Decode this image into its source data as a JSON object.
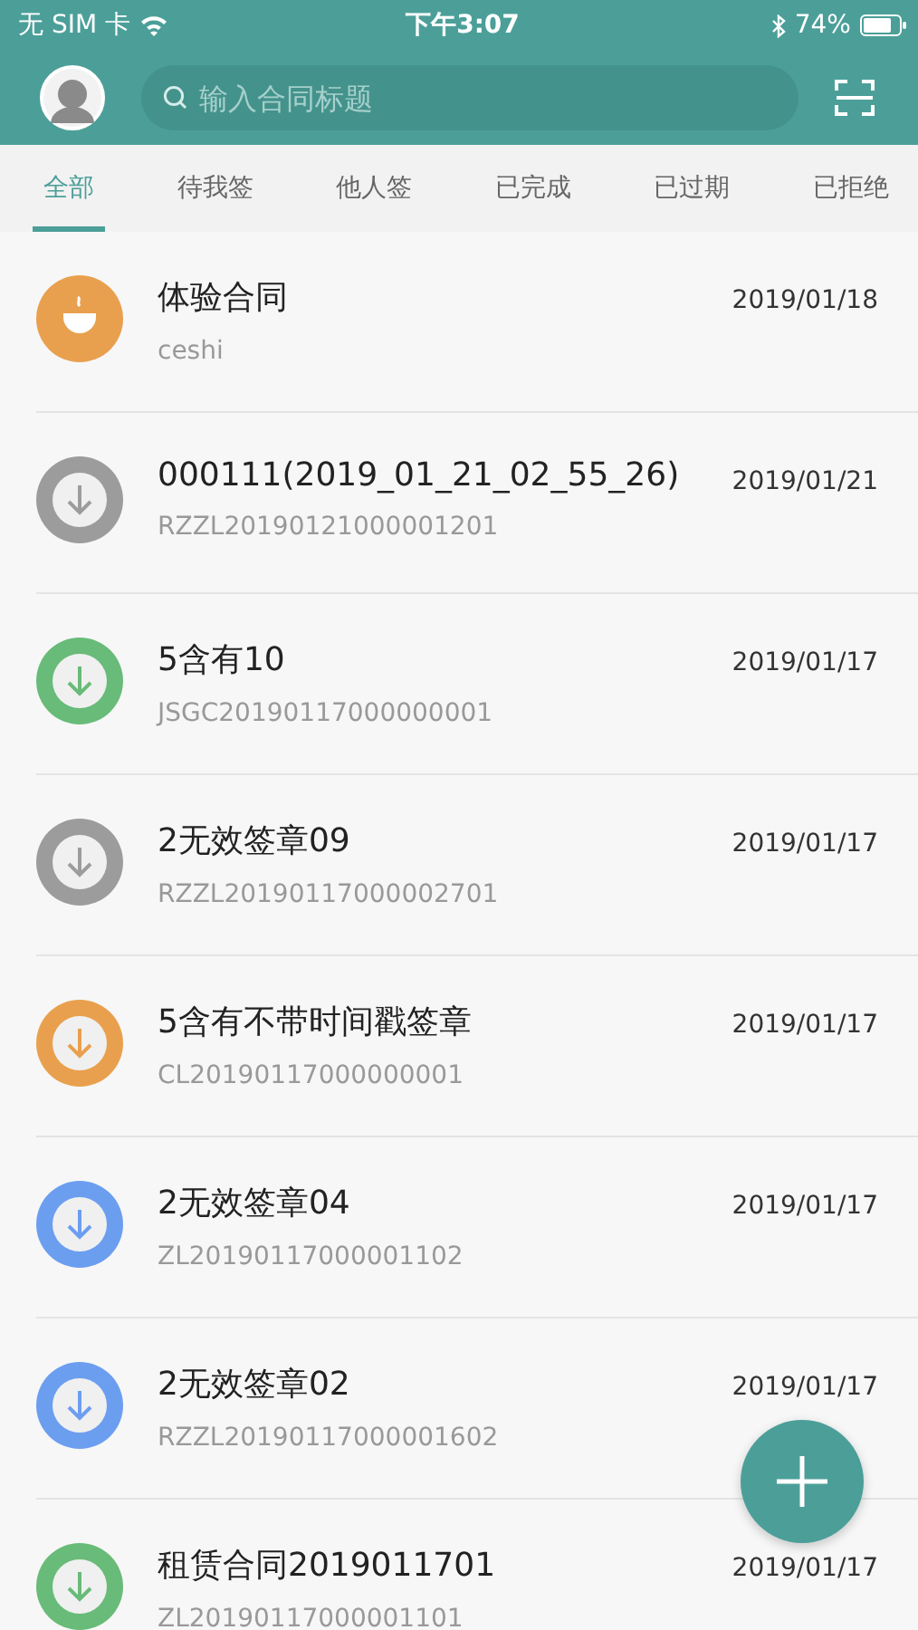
{
  "status_bar": {
    "carrier": "无 SIM 卡",
    "time": "下午3:07",
    "battery": "74%"
  },
  "search": {
    "placeholder": "输入合同标题"
  },
  "tabs": [
    {
      "label": "全部",
      "selected": true
    },
    {
      "label": "待我签",
      "selected": false
    },
    {
      "label": "他人签",
      "selected": false
    },
    {
      "label": "已完成",
      "selected": false
    },
    {
      "label": "已过期",
      "selected": false
    },
    {
      "label": "已拒绝",
      "selected": false
    }
  ],
  "contracts": [
    {
      "kind": "cup",
      "color": "#e9a04e",
      "title": "体验合同",
      "code": "ceshi",
      "date": "2019/01/18"
    },
    {
      "kind": "download",
      "color": "#9c9c9c",
      "title": "000111(2019_01_21_02_55_26)",
      "code": "RZZL20190121000001201",
      "date": "2019/01/21"
    },
    {
      "kind": "download",
      "color": "#68bb78",
      "title": "5含有10",
      "code": "JSGC20190117000000001",
      "date": "2019/01/17"
    },
    {
      "kind": "download",
      "color": "#9c9c9c",
      "title": "2无效签章09",
      "code": "RZZL20190117000002701",
      "date": "2019/01/17"
    },
    {
      "kind": "download",
      "color": "#e9a04e",
      "title": "5含有不带时间戳签章",
      "code": "CL20190117000000001",
      "date": "2019/01/17"
    },
    {
      "kind": "download",
      "color": "#6c9ef0",
      "title": "2无效签章04",
      "code": "ZL20190117000001102",
      "date": "2019/01/17"
    },
    {
      "kind": "download",
      "color": "#6c9ef0",
      "title": "2无效签章02",
      "code": "RZZL20190117000001602",
      "date": "2019/01/17"
    },
    {
      "kind": "download",
      "color": "#68bb78",
      "title": "租赁合同2019011701",
      "code": "ZL20190117000001101",
      "date": "2019/01/17"
    }
  ]
}
